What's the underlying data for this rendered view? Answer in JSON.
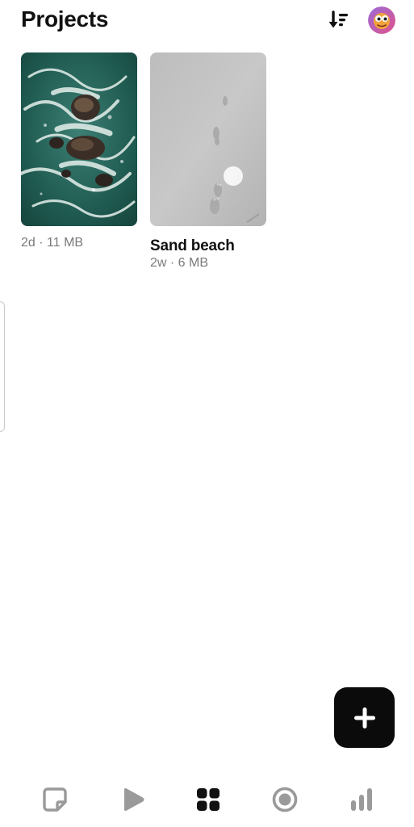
{
  "header": {
    "title": "Projects",
    "sort_icon": "sort-down-icon",
    "avatar_icon": "avatar-icon"
  },
  "projects": [
    {
      "title": "",
      "meta": "2d · 11 MB",
      "thumbnail": "ocean-rocks-aerial"
    },
    {
      "title": "Sand beach",
      "meta": "2w · 6 MB",
      "thumbnail": "sand-footprints"
    }
  ],
  "fab": {
    "icon": "plus-icon"
  },
  "bottom_nav": {
    "items": [
      {
        "icon": "sticky-note-icon",
        "active": false
      },
      {
        "icon": "play-icon",
        "active": false
      },
      {
        "icon": "grid-icon",
        "active": true
      },
      {
        "icon": "record-icon",
        "active": false
      },
      {
        "icon": "bar-chart-icon",
        "active": false
      }
    ]
  },
  "colors": {
    "text_primary": "#111111",
    "text_secondary": "#7a7a7a",
    "fab_bg": "#0b0b0b",
    "nav_inactive": "#9a9a9a",
    "nav_active": "#111111"
  }
}
